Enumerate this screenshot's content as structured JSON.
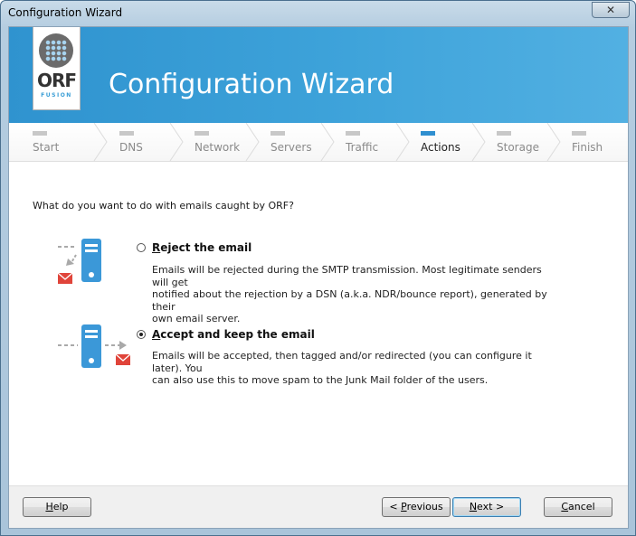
{
  "window": {
    "title": "Configuration Wizard",
    "close_glyph": "✕"
  },
  "banner": {
    "title": "Configuration Wizard",
    "logo_text": "ORF",
    "logo_sub": "FUSION"
  },
  "steps": [
    {
      "label": "Start",
      "active": false
    },
    {
      "label": "DNS",
      "active": false
    },
    {
      "label": "Network",
      "active": false
    },
    {
      "label": "Servers",
      "active": false
    },
    {
      "label": "Traffic",
      "active": false
    },
    {
      "label": "Actions",
      "active": true
    },
    {
      "label": "Storage",
      "active": false
    },
    {
      "label": "Finish",
      "active": false
    }
  ],
  "question": "What do you want to do with emails caught by ORF?",
  "options": [
    {
      "title_first": "R",
      "title_rest": "eject the email",
      "description_lines": [
        "Emails will be rejected during the SMTP transmission. Most legitimate senders will get",
        "notified about the rejection by a DSN (a.k.a. NDR/bounce report), generated by their",
        "own email server."
      ],
      "selected": false,
      "icon": "server-reject-icon"
    },
    {
      "title_first": "A",
      "title_rest": "ccept and keep the email",
      "description_lines": [
        "Emails will be accepted, then tagged and/or redirected (you can configure it later). You",
        "can also use this to move spam to the Junk Mail folder of the users."
      ],
      "selected": true,
      "icon": "server-accept-icon"
    }
  ],
  "buttons": {
    "help": {
      "first": "H",
      "rest": "elp"
    },
    "previous": {
      "pre": "< ",
      "first": "P",
      "rest": "revious"
    },
    "next": {
      "first": "N",
      "rest": "ext >"
    },
    "cancel": {
      "first": "C",
      "rest": "ancel"
    }
  },
  "colors": {
    "accent": "#2f8fd0",
    "banner": "#3ea3da",
    "mail_red": "#e0443a"
  }
}
